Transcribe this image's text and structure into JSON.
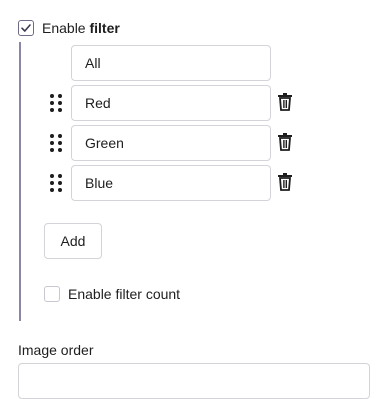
{
  "filter": {
    "enable_prefix": "Enable ",
    "enable_bold": "filter",
    "enabled": true,
    "all_value": "All",
    "items": [
      {
        "value": "Red"
      },
      {
        "value": "Green"
      },
      {
        "value": "Blue"
      }
    ],
    "add_label": "Add",
    "count_label": "Enable filter count",
    "count_enabled": false
  },
  "image_order": {
    "label": "Image order"
  },
  "colors": {
    "accent_line": "#8a86a6",
    "border": "#d4d4d8",
    "text": "#1e1e1e"
  },
  "icons": {
    "checkbox_checked": "checkmark-icon",
    "drag": "drag-handle-icon",
    "delete": "trash-icon"
  }
}
